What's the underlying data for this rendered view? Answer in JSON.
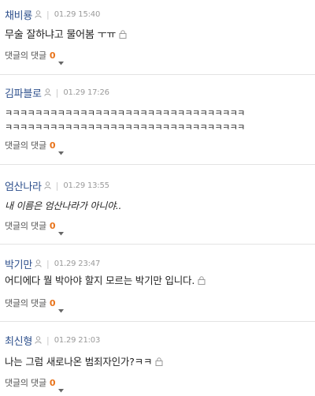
{
  "comments": [
    {
      "nickname": "채비룡",
      "date": "01.29 15:40",
      "text": "무술 잘하냐고 물어봄 ㅜㅠ",
      "reply_label": "댓글의 댓글",
      "reply_count": "0"
    },
    {
      "nickname": "김파블로",
      "date": "01.29 17:26",
      "text": "ㅋㅋㅋㅋㅋㅋㅋㅋㅋㅋㅋㅋㅋㅋㅋㅋㅋㅋㅋㅋㅋㅋㅋㅋㅋㅋㅋㅋㅋㅋㅋㅋ",
      "text2": "ㅋㅋㅋㅋㅋㅋㅋㅋㅋㅋㅋㅋㅋㅋㅋㅋㅋㅋㅋㅋㅋㅋㅋㅋㅋㅋㅋㅋㅋㅋㅋㅋ",
      "reply_label": "댓글의 댓글",
      "reply_count": "0"
    },
    {
      "nickname": "엄산나라",
      "date": "01.29 13:55",
      "text": "내 이름은 엄산나라가 아니야..",
      "reply_label": "댓글의 댓글",
      "reply_count": "0"
    },
    {
      "nickname": "박기만",
      "date": "01.29 23:47",
      "text": "어디에다 뭘 박아야 할지 모르는 박기만 입니다.",
      "reply_label": "댓글의 댓글",
      "reply_count": "0"
    },
    {
      "nickname": "최신형",
      "date": "01.29 21:03",
      "text": "나는 그럼 새로나온 범죄자인가?ㅋㅋ",
      "reply_label": "댓글의 댓글",
      "reply_count": "0"
    }
  ],
  "colors": {
    "nickname": "#2d4f8c",
    "reply_count": "#e8731a",
    "divider": "#e3e3e3"
  },
  "icons": {
    "user": "person-outline-icon",
    "lock": "lock-icon",
    "dropdown": "caret-down-icon"
  }
}
